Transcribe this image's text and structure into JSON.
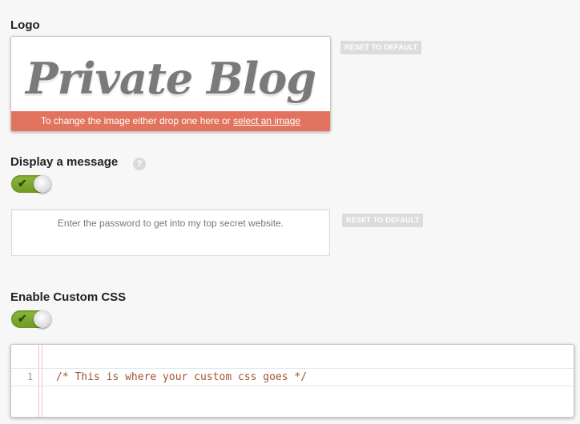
{
  "logo_section": {
    "title": "Logo",
    "logo_text": "Private Blog",
    "drop_text": "To change the image either drop one here or ",
    "select_link": "select an image",
    "reset_label": "RESET TO DEFAULT"
  },
  "message_section": {
    "title": "Display a message",
    "help_icon_glyph": "?",
    "toggle_on": true,
    "message_text": "Enter the password to get into my top secret website.",
    "reset_label": "RESET TO DEFAULT"
  },
  "css_section": {
    "title": "Enable Custom CSS",
    "toggle_on": true,
    "line_number": "1",
    "code": "/* This is where your custom css goes */"
  },
  "colors": {
    "accent_bar": "#e2735e",
    "toggle_green": "#7ca92f",
    "code_comment": "#a0522d"
  }
}
